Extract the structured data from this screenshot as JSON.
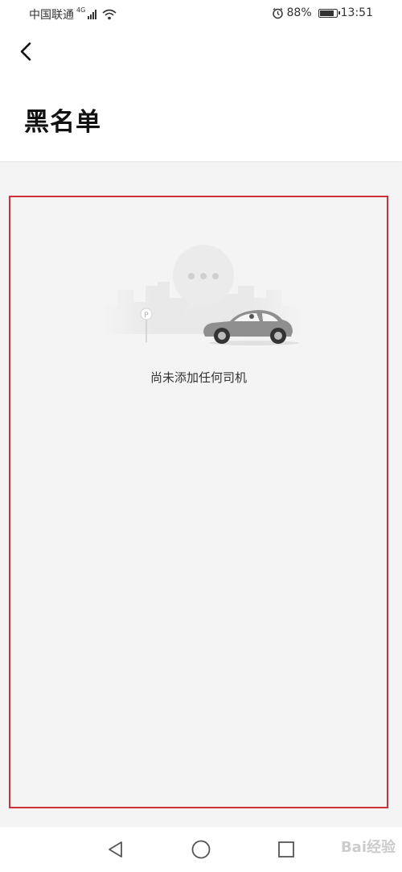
{
  "status_bar": {
    "carrier": "中国联通",
    "network": "4G",
    "battery": "88%",
    "time": "13:51",
    "battery_level": 0.88
  },
  "header": {
    "title": "黑名单"
  },
  "empty_state": {
    "message": "尚未添加任何司机",
    "parking_sign": "P"
  },
  "watermark": {
    "text": "Bai经验"
  },
  "colors": {
    "accent_border": "#d0303a",
    "background": "#f4f4f4",
    "car_body": "#8f8f8f"
  },
  "icons": {
    "back": "back-arrow-icon",
    "alarm": "alarm-icon",
    "wifi": "wifi-icon",
    "nav_back": "nav-back-icon",
    "nav_home": "nav-home-icon",
    "nav_recent": "nav-recent-icon"
  }
}
